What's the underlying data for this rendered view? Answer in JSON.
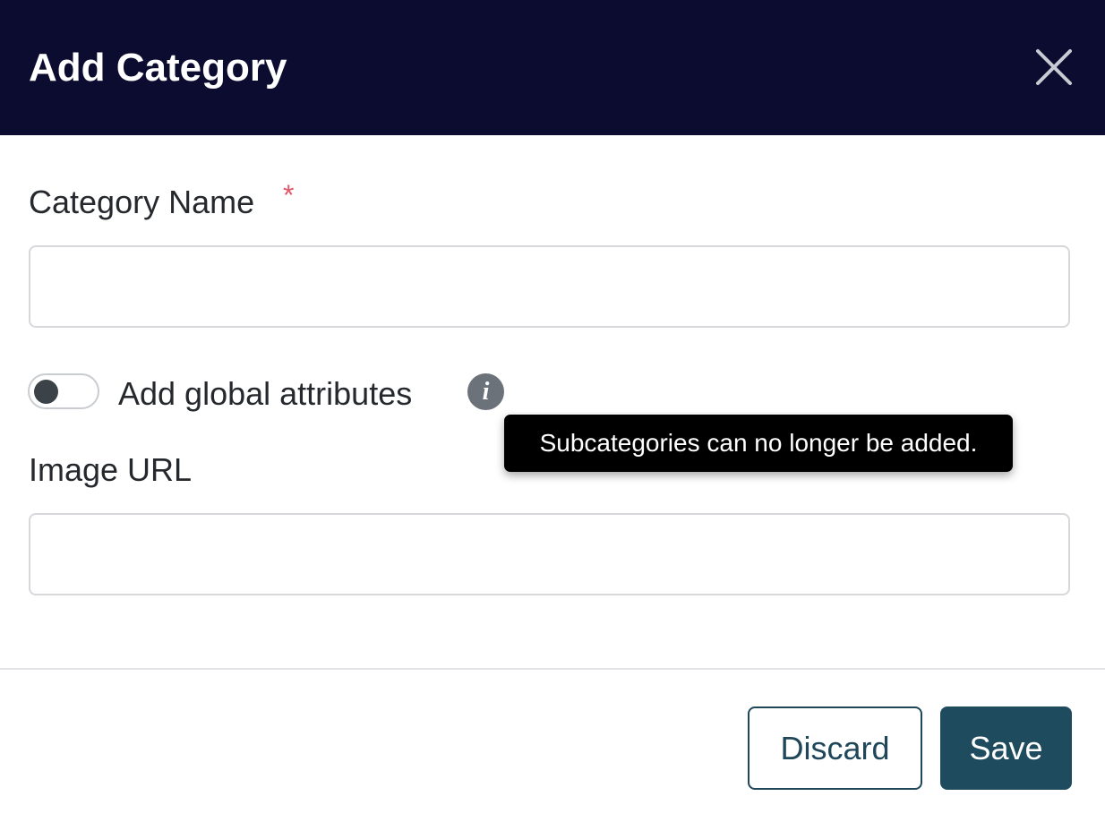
{
  "modal": {
    "title": "Add Category"
  },
  "form": {
    "category_name": {
      "label": "Category Name",
      "required_marker": "*",
      "value": "",
      "placeholder": ""
    },
    "global_attributes": {
      "label": "Add global attributes",
      "enabled": false
    },
    "info_icon_glyph": "i",
    "tooltip": "Subcategories can no longer be added.",
    "image_url": {
      "label": "Image URL",
      "value": "",
      "placeholder": ""
    }
  },
  "footer": {
    "discard_label": "Discard",
    "save_label": "Save"
  },
  "icons": {
    "close": "close-icon",
    "info": "info-icon"
  },
  "colors": {
    "header_background": "#0c0c30",
    "primary": "#1f4b5f",
    "required": "#e0576a",
    "tooltip_background": "#000000"
  }
}
